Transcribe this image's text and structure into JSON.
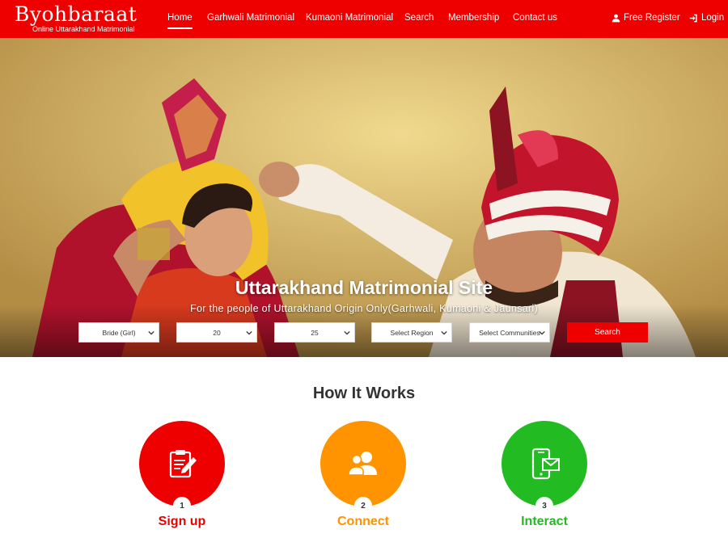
{
  "brand": {
    "name": "Byohbaraat",
    "tagline": "Online Uttarakhand Matrimonial"
  },
  "nav": {
    "items": [
      {
        "label": "Home",
        "active": true
      },
      {
        "label": "Garhwali Matrimonial"
      },
      {
        "label": "Kumaoni Matrimonial"
      },
      {
        "label": "Search"
      },
      {
        "label": "Membership"
      },
      {
        "label": "Contact us"
      }
    ],
    "register_label": "Free Register",
    "register_icon": "user-icon",
    "login_label": "Login",
    "login_icon": "sign-in-icon"
  },
  "hero": {
    "title": "Uttarakhand Matrimonial Site",
    "subtitle": "For the people of Uttarakhand Origin Only(Garhwali, Kumaoni & Jaunsari)"
  },
  "search": {
    "looking_for": "Bride (Girl)",
    "age_from": "20",
    "age_to": "25",
    "region": "Select Region",
    "community": "Select Communities",
    "button_label": "Search"
  },
  "how_it_works": {
    "title": "How It Works",
    "steps": [
      {
        "number": "1",
        "label": "Sign up",
        "color": "#ee0000",
        "icon": "clipboard-pen-icon"
      },
      {
        "number": "2",
        "label": "Connect",
        "color": "#ff9400",
        "icon": "users-icon"
      },
      {
        "number": "3",
        "label": "Interact",
        "color": "#22bb22",
        "icon": "mobile-mail-icon"
      }
    ]
  },
  "colors": {
    "brand_red": "#ee0000",
    "accent_orange": "#ff9400",
    "accent_green": "#22bb22"
  }
}
